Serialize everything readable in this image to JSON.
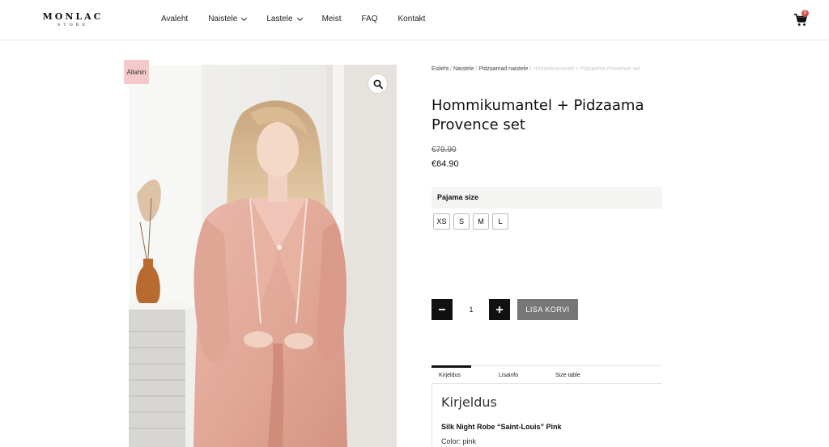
{
  "brand": {
    "name": "MONLAC",
    "tagline": "STORE"
  },
  "nav": {
    "items": [
      {
        "label": "Avaleht",
        "dropdown": false
      },
      {
        "label": "Naistele",
        "dropdown": true
      },
      {
        "label": "Lastele",
        "dropdown": true
      },
      {
        "label": "Meist",
        "dropdown": false
      },
      {
        "label": "FAQ",
        "dropdown": false
      },
      {
        "label": "Kontakt",
        "dropdown": false
      }
    ],
    "cart_count": "0"
  },
  "product": {
    "sale_badge": "Allahin",
    "breadcrumb": [
      "Esileht",
      "Naistele",
      "Pidzaamad naistele",
      "Hommikumantel + Pidzaama Provence set"
    ],
    "title": "Hommikumantel + Pidzaama Provence set",
    "old_price": "€79.90",
    "price": "€64.90",
    "attribute_label": "Pajama size",
    "sizes": [
      "XS",
      "S",
      "M",
      "L"
    ],
    "quantity": "1",
    "add_to_cart": "LISA KORVI"
  },
  "tabs": {
    "items": [
      "Kirjeldus",
      "Lisainfo",
      "Size table"
    ],
    "active": "Kirjeldus"
  },
  "description": {
    "heading": "Kirjeldus",
    "subheading": "Silk Night Robe “Saint-Louis” Pink",
    "color_line": "Color: pink"
  },
  "colors": {
    "badge": "#f4c9cc",
    "button_dark": "#111111",
    "add_to_cart": "#777777",
    "cart_badge": "#d9534f"
  },
  "icons": {
    "zoom": "magnifier-icon",
    "cart": "shopping-cart-icon",
    "dropdown": "chevron-down-icon"
  }
}
